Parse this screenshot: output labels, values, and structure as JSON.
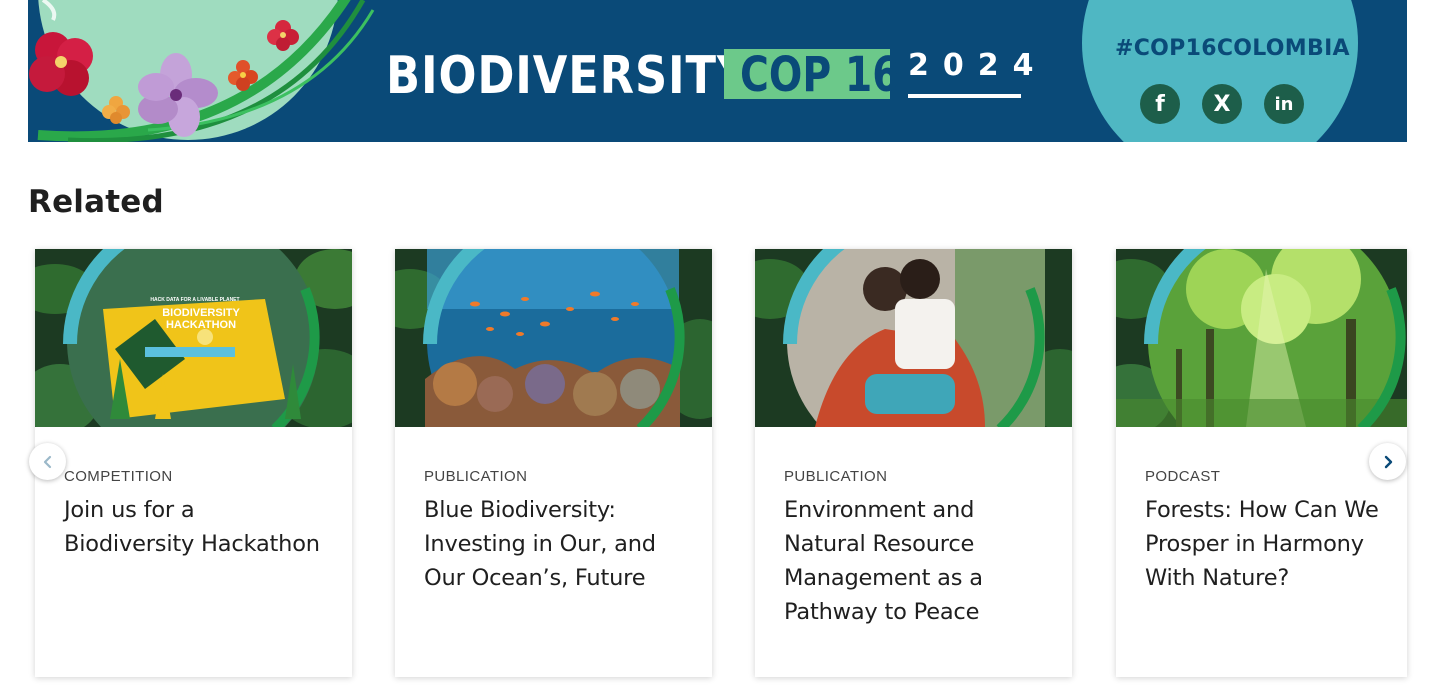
{
  "banner": {
    "title_word": "BIODIVERSITY",
    "cop_label": "COP 16",
    "year": "2024",
    "hashtag": "#COP16COLOMBIA",
    "social": [
      {
        "name": "facebook-icon",
        "glyph": "f"
      },
      {
        "name": "x-icon",
        "glyph": "X"
      },
      {
        "name": "linkedin-icon",
        "glyph": "in"
      }
    ],
    "colors": {
      "background": "#0a4a78",
      "accent_green": "#6cc98a",
      "teal": "#4fb7c3"
    }
  },
  "related": {
    "heading": "Related",
    "cards": [
      {
        "type": "COMPETITION",
        "title": "Join us for a Biodiversity Hackathon",
        "image": "hackathon-poster"
      },
      {
        "type": "PUBLICATION",
        "title": "Blue Biodiversity: Investing in Our, and Our Ocean’s, Future",
        "image": "coral-reef"
      },
      {
        "type": "PUBLICATION",
        "title": "Environment and Natural Resource Management as a Pathway to Peace",
        "image": "woman-carrying-child"
      },
      {
        "type": "PODCAST",
        "title": "Forests: How Can We Prosper in Harmony With Nature?",
        "image": "sunlit-forest"
      }
    ]
  },
  "carousel": {
    "prev_icon": "chevron-left-icon",
    "next_icon": "chevron-right-icon"
  }
}
